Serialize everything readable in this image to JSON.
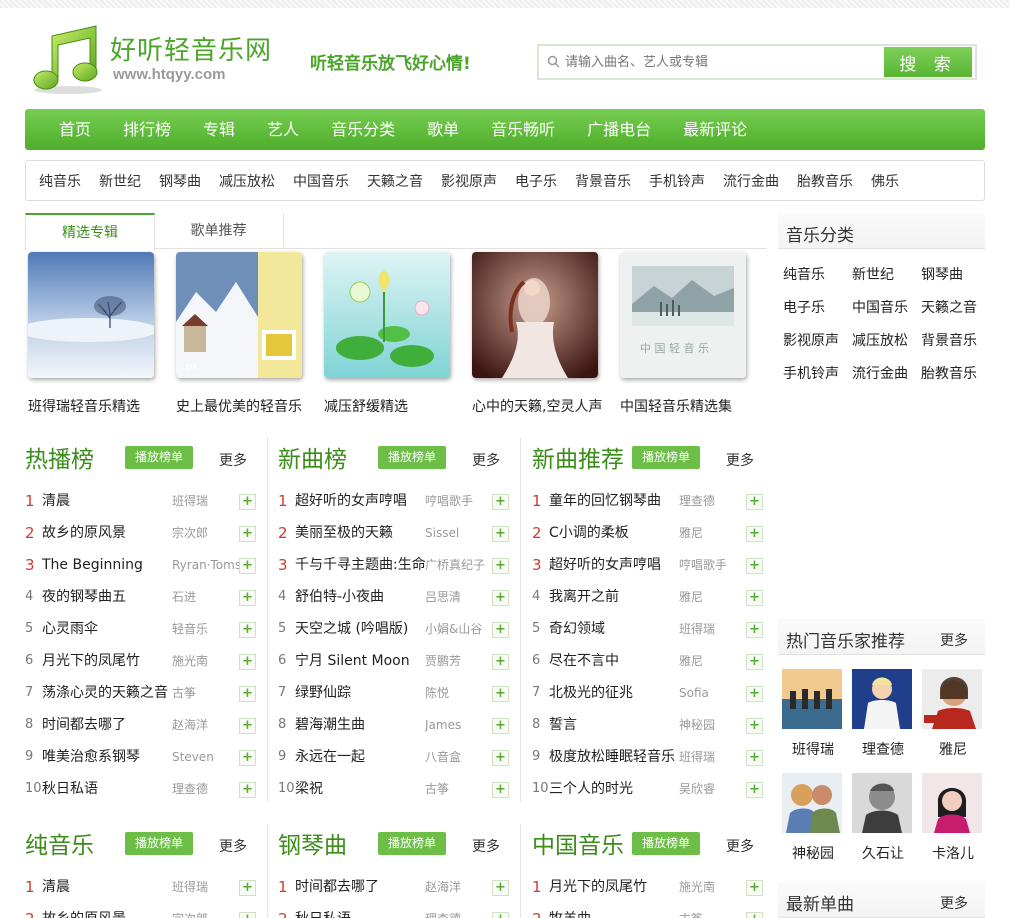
{
  "header": {
    "site_title": "好听轻音乐网",
    "site_url": "www.htqyy.com",
    "slogan": "听轻音乐放飞好心情!",
    "search_placeholder": "请输入曲名、艺人或专辑",
    "search_button": "搜 索"
  },
  "main_nav": [
    "首页",
    "排行榜",
    "专辑",
    "艺人",
    "音乐分类",
    "歌单",
    "音乐畅听",
    "广播电台",
    "最新评论"
  ],
  "sub_nav": [
    "纯音乐",
    "新世纪",
    "钢琴曲",
    "减压放松",
    "中国音乐",
    "天籁之音",
    "影视原声",
    "电子乐",
    "背景音乐",
    "手机铃声",
    "流行金曲",
    "胎教音乐",
    "佛乐"
  ],
  "tabs": [
    "精选专辑",
    "歌单推荐"
  ],
  "albums": [
    "班得瑞轻音乐精选",
    "史上最优美的轻音乐",
    "减压舒缓精选",
    "心中的天籁,空灵人声",
    "中国轻音乐精选集"
  ],
  "play_label": "播放榜单",
  "more_label": "更多",
  "charts": [
    {
      "title": "热播榜",
      "songs": [
        {
          "num": "1",
          "song": "清晨",
          "artist": "班得瑞"
        },
        {
          "num": "2",
          "song": "故乡的原风景",
          "artist": "宗次郎"
        },
        {
          "num": "3",
          "song": "The Beginning",
          "artist": "Ryran·Toms"
        },
        {
          "num": "4",
          "song": "夜的钢琴曲五",
          "artist": "石进"
        },
        {
          "num": "5",
          "song": "心灵雨伞",
          "artist": "轻音乐"
        },
        {
          "num": "6",
          "song": "月光下的凤尾竹",
          "artist": "施光南"
        },
        {
          "num": "7",
          "song": "荡涤心灵的天籁之音",
          "artist": "古筝"
        },
        {
          "num": "8",
          "song": "时间都去哪了",
          "artist": "赵海洋"
        },
        {
          "num": "9",
          "song": "唯美治愈系钢琴",
          "artist": "Steven"
        },
        {
          "num": "10",
          "song": "秋日私语",
          "artist": "理查德"
        }
      ]
    },
    {
      "title": "新曲榜",
      "songs": [
        {
          "num": "1",
          "song": "超好听的女声哼唱",
          "artist": "哼唱歌手"
        },
        {
          "num": "2",
          "song": "美丽至极的天籁",
          "artist": "Sissel"
        },
        {
          "num": "3",
          "song": "千与千寻主题曲:生命",
          "artist": "广桥真纪子"
        },
        {
          "num": "4",
          "song": "舒伯特-小夜曲",
          "artist": "吕思清"
        },
        {
          "num": "5",
          "song": "天空之城 (吟唱版)",
          "artist": "小娟&山谷"
        },
        {
          "num": "6",
          "song": "宁月 Silent Moon",
          "artist": "贾鹏芳"
        },
        {
          "num": "7",
          "song": "绿野仙踪",
          "artist": "陈悦"
        },
        {
          "num": "8",
          "song": "碧海潮生曲",
          "artist": "James"
        },
        {
          "num": "9",
          "song": "永远在一起",
          "artist": "八音盒"
        },
        {
          "num": "10",
          "song": "梁祝",
          "artist": "古筝"
        }
      ]
    },
    {
      "title": "新曲推荐",
      "songs": [
        {
          "num": "1",
          "song": "童年的回忆钢琴曲",
          "artist": "理查德"
        },
        {
          "num": "2",
          "song": "C小调的柔板",
          "artist": "雅尼"
        },
        {
          "num": "3",
          "song": "超好听的女声哼唱",
          "artist": "哼唱歌手"
        },
        {
          "num": "4",
          "song": "我离开之前",
          "artist": "雅尼"
        },
        {
          "num": "5",
          "song": "奇幻领域",
          "artist": "班得瑞"
        },
        {
          "num": "6",
          "song": "尽在不言中",
          "artist": "雅尼"
        },
        {
          "num": "7",
          "song": "北极光的征兆",
          "artist": "Sofia"
        },
        {
          "num": "8",
          "song": "誓言",
          "artist": "神秘园"
        },
        {
          "num": "9",
          "song": "极度放松睡眠轻音乐",
          "artist": "班得瑞"
        },
        {
          "num": "10",
          "song": "三个人的时光",
          "artist": "吴欣睿"
        }
      ]
    },
    {
      "title": "纯音乐",
      "songs": [
        {
          "num": "1",
          "song": "清晨",
          "artist": "班得瑞"
        },
        {
          "num": "2",
          "song": "故乡的原风景",
          "artist": "宗次郎"
        }
      ]
    },
    {
      "title": "钢琴曲",
      "songs": [
        {
          "num": "1",
          "song": "时间都去哪了",
          "artist": "赵海洋"
        },
        {
          "num": "2",
          "song": "秋日私语",
          "artist": "理查德"
        }
      ]
    },
    {
      "title": "中国音乐",
      "songs": [
        {
          "num": "1",
          "song": "月光下的凤尾竹",
          "artist": "施光南"
        },
        {
          "num": "2",
          "song": "牧羊曲",
          "artist": "古筝"
        }
      ]
    }
  ],
  "sidebar": {
    "categories_title": "音乐分类",
    "categories": [
      "纯音乐",
      "新世纪",
      "钢琴曲",
      "电子乐",
      "中国音乐",
      "天籁之音",
      "影视原声",
      "减压放松",
      "背景音乐",
      "手机铃声",
      "流行金曲",
      "胎教音乐"
    ],
    "musicians_title": "热门音乐家推荐",
    "musicians": [
      "班得瑞",
      "理查德",
      "雅尼",
      "神秘园",
      "久石让",
      "卡洛儿"
    ],
    "new_title": "最新单曲",
    "more": "更多"
  },
  "accent_color": "#4aa52a"
}
